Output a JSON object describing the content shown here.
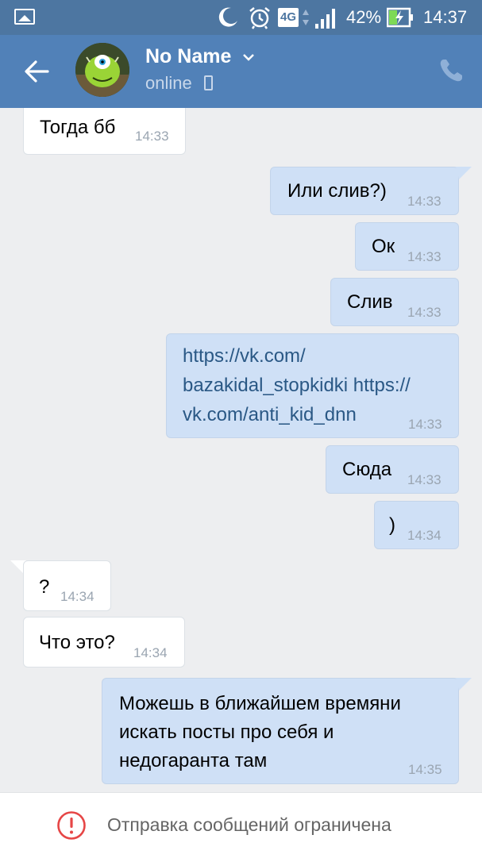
{
  "status_bar": {
    "network": "4G",
    "battery_percent": "42%",
    "time": "14:37",
    "icons": [
      "gallery-icon",
      "moon-icon",
      "alarm-icon",
      "signal-icon",
      "battery-charging-icon"
    ]
  },
  "header": {
    "contact_name": "No Name",
    "status": "online",
    "icons": [
      "back-arrow-icon",
      "chevron-down-icon",
      "mobile-icon",
      "phone-icon"
    ]
  },
  "messages": [
    {
      "dir": "in",
      "text": "Тогда бб",
      "time": "14:33"
    },
    {
      "dir": "out",
      "text": "Или слив?)",
      "time": "14:33"
    },
    {
      "dir": "out",
      "text": "Ок",
      "time": "14:33"
    },
    {
      "dir": "out",
      "text": "Слив",
      "time": "14:33"
    },
    {
      "dir": "out",
      "lines": [
        "https://vk.com/",
        "bazakidal_stopkidki https://",
        "vk.com/anti_kid_dnn"
      ],
      "time": "14:33"
    },
    {
      "dir": "out",
      "text": "Сюда",
      "time": "14:33"
    },
    {
      "dir": "out",
      "text": ")",
      "time": "14:34"
    },
    {
      "dir": "in",
      "text": "?",
      "time": "14:34"
    },
    {
      "dir": "in",
      "text": "Что это?",
      "time": "14:34"
    },
    {
      "dir": "out",
      "lines": [
        "Можешь в ближайшем времяни",
        "искать посты про себя и",
        "недогаранта там"
      ],
      "time": "14:35"
    }
  ],
  "restriction": {
    "text": "Отправка сообщений ограничена"
  },
  "colors": {
    "status_bar": "#4d76a1",
    "header": "#5181b8",
    "background": "#edeef0",
    "outgoing_bubble": "#cfe0f6",
    "incoming_bubble": "#ffffff",
    "link": "#2a5885",
    "warning": "#e64646"
  }
}
